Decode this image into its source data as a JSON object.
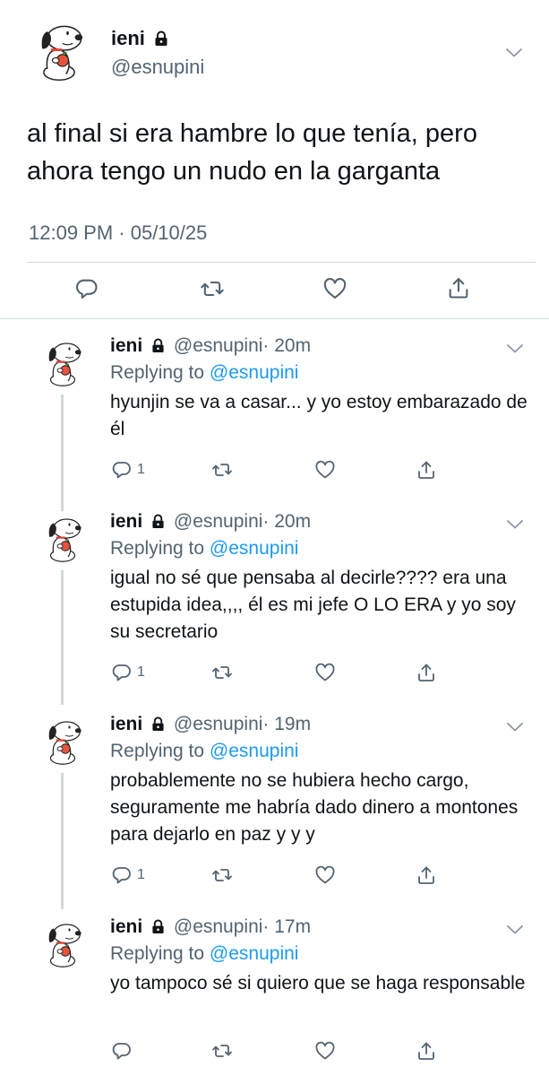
{
  "main_tweet": {
    "name": "ieni",
    "handle": "@esnupini",
    "text": "al final si era hambre lo que tenía, pero ahora tengo un nudo en la garganta",
    "timestamp": "12:09 PM · 05/10/25"
  },
  "replies": [
    {
      "name": "ieni",
      "handle": "@esnupini",
      "time": "· 20m",
      "replying_prefix": "Replying to ",
      "replying_mention": "@esnupini",
      "text": "hyunjin se va a casar... y yo estoy embarazado de él",
      "reply_count": "1"
    },
    {
      "name": "ieni",
      "handle": "@esnupini",
      "time": "· 20m",
      "replying_prefix": "Replying to ",
      "replying_mention": "@esnupini",
      "text": "igual no sé que pensaba al decirle???? era una estupida idea,,,, él es mi jefe O LO ERA y yo soy su secretario",
      "reply_count": "1"
    },
    {
      "name": "ieni",
      "handle": "@esnupini",
      "time": "· 19m",
      "replying_prefix": "Replying to ",
      "replying_mention": "@esnupini",
      "text": "probablemente no se hubiera hecho cargo, seguramente me habría dado dinero a montones para dejarlo en paz y y  y",
      "reply_count": "1"
    },
    {
      "name": "ieni",
      "handle": "@esnupini",
      "time": "· 17m",
      "replying_prefix": "Replying to ",
      "replying_mention": "@esnupini",
      "text": "yo tampoco sé si quiero que se haga responsable",
      "reply_count": ""
    }
  ],
  "icons": {
    "lock": "lock-icon",
    "chevron": "chevron-down-icon",
    "reply": "reply-icon",
    "retweet": "retweet-icon",
    "like": "heart-icon",
    "share": "share-icon"
  },
  "colors": {
    "text": "#0f1419",
    "secondary": "#536471",
    "link": "#1d9bf0",
    "divider": "#cfd9de"
  }
}
